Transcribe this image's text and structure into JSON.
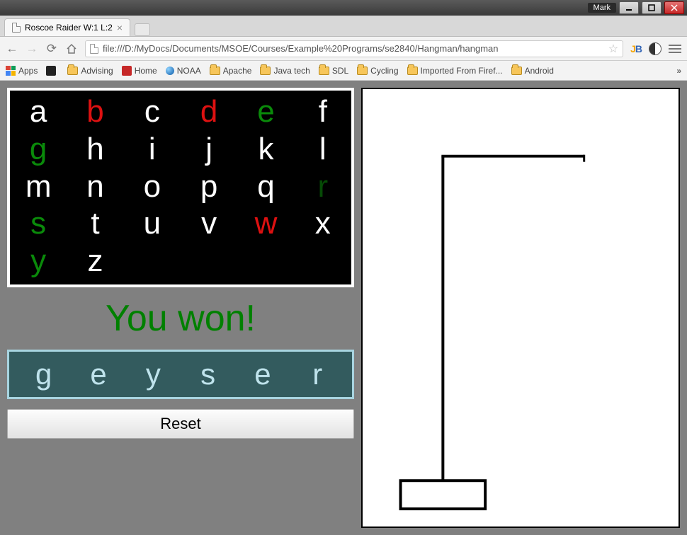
{
  "window": {
    "user": "Mark",
    "tab_title": "Roscoe Raider W:1 L:2",
    "url": "file:///D:/MyDocs/Documents/MSOE/Courses/Example%20Programs/se2840/Hangman/hangman"
  },
  "bookmarks": {
    "apps": "Apps",
    "items": [
      {
        "label": "",
        "icon": "square-black"
      },
      {
        "label": "Advising",
        "icon": "folder"
      },
      {
        "label": "Home",
        "icon": "red-square"
      },
      {
        "label": "NOAA",
        "icon": "blue-dot"
      },
      {
        "label": "Apache",
        "icon": "folder"
      },
      {
        "label": "Java tech",
        "icon": "folder"
      },
      {
        "label": "SDL",
        "icon": "folder"
      },
      {
        "label": "Cycling",
        "icon": "folder"
      },
      {
        "label": "Imported From Firef...",
        "icon": "folder"
      },
      {
        "label": "Android",
        "icon": "folder"
      }
    ]
  },
  "game": {
    "alphabet": [
      {
        "ch": "a",
        "state": "unused"
      },
      {
        "ch": "b",
        "state": "wrong"
      },
      {
        "ch": "c",
        "state": "unused"
      },
      {
        "ch": "d",
        "state": "wrong"
      },
      {
        "ch": "e",
        "state": "correct"
      },
      {
        "ch": "f",
        "state": "unused"
      },
      {
        "ch": "g",
        "state": "correct"
      },
      {
        "ch": "h",
        "state": "unused"
      },
      {
        "ch": "i",
        "state": "unused"
      },
      {
        "ch": "j",
        "state": "unused"
      },
      {
        "ch": "k",
        "state": "unused"
      },
      {
        "ch": "l",
        "state": "unused"
      },
      {
        "ch": "m",
        "state": "unused"
      },
      {
        "ch": "n",
        "state": "unused"
      },
      {
        "ch": "o",
        "state": "unused"
      },
      {
        "ch": "p",
        "state": "unused"
      },
      {
        "ch": "q",
        "state": "unused"
      },
      {
        "ch": "r",
        "state": "dark-correct"
      },
      {
        "ch": "s",
        "state": "correct"
      },
      {
        "ch": "t",
        "state": "unused"
      },
      {
        "ch": "u",
        "state": "unused"
      },
      {
        "ch": "v",
        "state": "unused"
      },
      {
        "ch": "w",
        "state": "wrong"
      },
      {
        "ch": "x",
        "state": "unused"
      },
      {
        "ch": "y",
        "state": "correct"
      },
      {
        "ch": "z",
        "state": "unused"
      }
    ],
    "status_text": "You won!",
    "word": [
      "g",
      "e",
      "y",
      "s",
      "e",
      "r"
    ],
    "reset_label": "Reset",
    "wrong_guesses": 3,
    "gallows_stage": 0
  }
}
